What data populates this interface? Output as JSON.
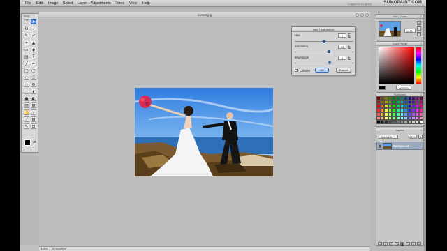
{
  "menubar": {
    "items": [
      "File",
      "Edit",
      "Image",
      "Select",
      "Layer",
      "Adjustments",
      "Filters",
      "View",
      "Help"
    ],
    "login_text": "Logged in as guest",
    "brand": "SUMOPAINT.COM"
  },
  "tools_panel": {
    "title": "Tools"
  },
  "document": {
    "title": "sunset.jpg",
    "zoom": "100%",
    "size": "979x636px"
  },
  "dialog": {
    "title": "Hue / Saturation",
    "hue_label": "Hue",
    "hue_value": "0",
    "saturation_label": "Saturation",
    "saturation_value": "32",
    "brightness_label": "Brightness",
    "brightness_value": "0",
    "colorize_label": "Colorize",
    "ok_label": "OK",
    "cancel_label": "Cancel",
    "levels": {
      "hue": 0.5,
      "saturation": 0.58,
      "brightness": 0.6
    }
  },
  "panels": {
    "info": {
      "title": "Info / Zoom",
      "zoom": "100%"
    },
    "color_picker": {
      "title": "Color Picker",
      "hex": "000000"
    },
    "swatches": {
      "title": "Swatches"
    },
    "layers": {
      "title": "Layers",
      "blend_mode": "Normal",
      "opacity": "100%",
      "layer_name": "Background"
    }
  },
  "colors": {
    "accent": "#3a6fbf",
    "workspace": "#b9b9b9",
    "panel": "#c6c6c6",
    "layer_selected": "#9aa9bb"
  }
}
